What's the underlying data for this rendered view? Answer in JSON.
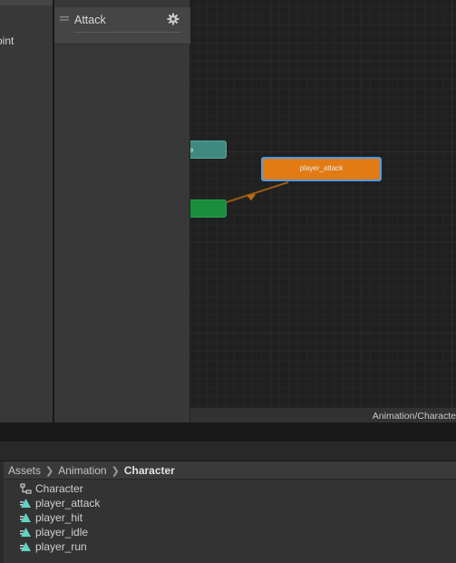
{
  "left_panel": {
    "clipped_text": "oint"
  },
  "layers": {
    "items": [
      {
        "label": "Attack",
        "handle_icon": "drag-handle-icon",
        "settings_icon": "gear-icon"
      }
    ]
  },
  "graph": {
    "nodes": {
      "teal_label": "e",
      "attack_label": "player_attack"
    },
    "footer_path": "Animation/Characte"
  },
  "project": {
    "breadcrumb": [
      "Assets",
      "Animation",
      "Character"
    ],
    "assets": [
      {
        "name": "Character",
        "icon": "animator-controller-icon"
      },
      {
        "name": "player_attack",
        "icon": "animation-clip-icon"
      },
      {
        "name": "player_hit",
        "icon": "animation-clip-icon"
      },
      {
        "name": "player_idle",
        "icon": "animation-clip-icon"
      },
      {
        "name": "player_run",
        "icon": "animation-clip-icon"
      }
    ]
  },
  "colors": {
    "attack_node": "#e27b14",
    "selection": "#4c9be8",
    "green_node": "#1b8d3e",
    "teal_node": "#3f8a7e",
    "clip_icon": "#5fd3c4"
  }
}
